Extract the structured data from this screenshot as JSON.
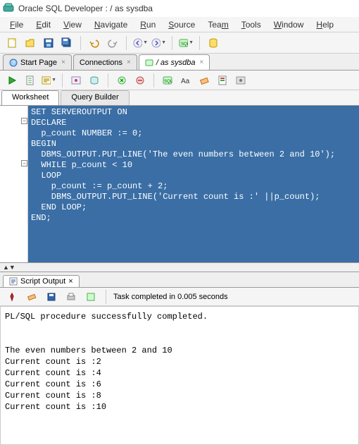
{
  "title": "Oracle SQL Developer : / as sysdba",
  "menus": [
    "File",
    "Edit",
    "View",
    "Navigate",
    "Run",
    "Source",
    "Team",
    "Tools",
    "Window",
    "Help"
  ],
  "tabs": {
    "start": "Start Page",
    "connections": "Connections",
    "active": "/ as sysdba"
  },
  "subtabs": {
    "worksheet": "Worksheet",
    "querybuilder": "Query Builder"
  },
  "code": "SET SERVEROUTPUT ON\nDECLARE\n  p_count NUMBER := 0;\nBEGIN\n  DBMS_OUTPUT.PUT_LINE('The even numbers between 2 and 10');\n  WHILE p_count < 10\n  LOOP\n    p_count := p_count + 2;\n    DBMS_OUTPUT.PUT_LINE('Current count is :' ||p_count);\n  END LOOP;\nEND;",
  "splitter_markers": "▲▼",
  "output_tab": "Script Output",
  "output_status": "Task completed in 0.005 seconds",
  "output_text": "PL/SQL procedure successfully completed.\n\n\nThe even numbers between 2 and 10\nCurrent count is :2\nCurrent count is :4\nCurrent count is :6\nCurrent count is :8\nCurrent count is :10"
}
